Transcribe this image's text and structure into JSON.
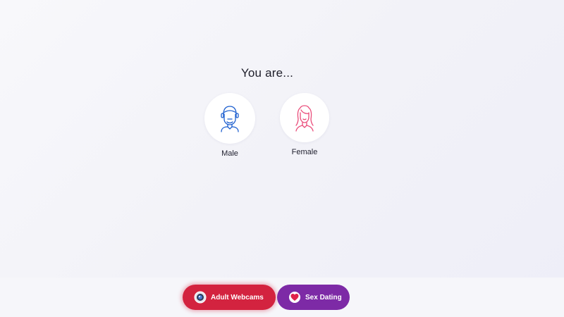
{
  "prompt": "You are...",
  "options": [
    {
      "label": "Male",
      "icon": "male-avatar-icon",
      "color": "#1d5fcf"
    },
    {
      "label": "Female",
      "icon": "female-avatar-icon",
      "color": "#ea4c7a"
    }
  ],
  "ads": [
    {
      "label": "Adult Webcams",
      "icon": "webcam-icon",
      "color": "#d3233f"
    },
    {
      "label": "Sex Dating",
      "icon": "heart-icon",
      "color": "#7d2aa6"
    }
  ]
}
